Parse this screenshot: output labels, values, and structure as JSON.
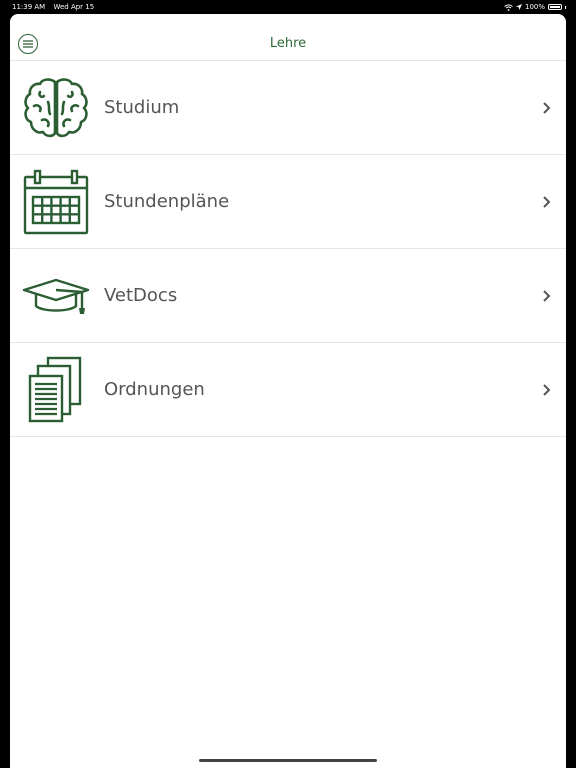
{
  "status_bar": {
    "time": "11:39 AM",
    "date": "Wed Apr 15",
    "battery": "100%"
  },
  "nav": {
    "title": "Lehre",
    "menu_icon": "menu-circle-icon"
  },
  "items": [
    {
      "label": "Studium",
      "icon": "brain-icon"
    },
    {
      "label": "Stundenpläne",
      "icon": "calendar-icon"
    },
    {
      "label": "VetDocs",
      "icon": "graduation-cap-icon"
    },
    {
      "label": "Ordnungen",
      "icon": "documents-icon"
    }
  ],
  "colors": {
    "accent": "#2c6b3a",
    "text": "#555555"
  }
}
